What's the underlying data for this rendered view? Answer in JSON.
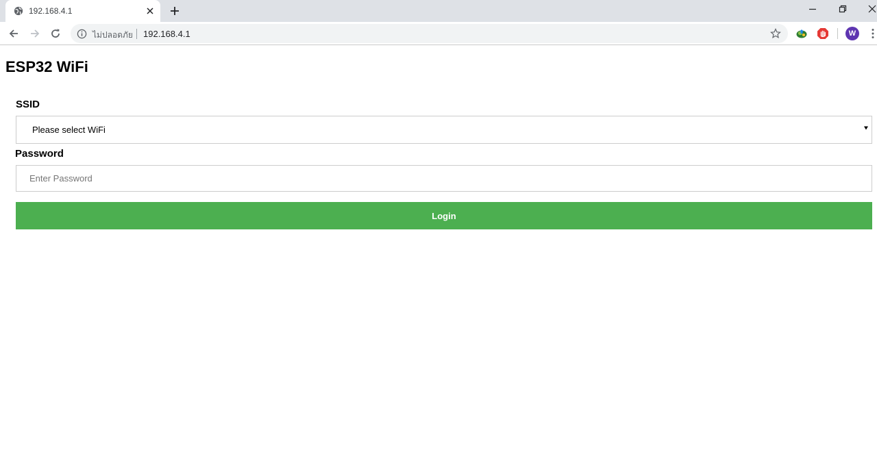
{
  "browser": {
    "tab": {
      "title": "192.168.4.1"
    },
    "address_bar": {
      "security_label": "ไม่ปลอดภัย",
      "url": "192.168.4.1"
    },
    "profile": {
      "initial": "W"
    },
    "icons": {
      "favicon": "globe-icon",
      "tab_close": "close-icon",
      "new_tab": "plus-icon",
      "minimize": "minimize-icon",
      "restore": "restore-icon",
      "close": "close-window-icon",
      "back": "back-arrow-icon",
      "forward": "forward-arrow-icon",
      "reload": "reload-icon",
      "info": "info-icon",
      "bookmark": "star-icon",
      "menu": "kebab-menu-icon"
    }
  },
  "page": {
    "title": "ESP32 WiFi",
    "form": {
      "ssid_label": "SSID",
      "ssid_selected": "Please select WiFi",
      "password_label": "Password",
      "password_placeholder": "Enter Password",
      "password_value": "",
      "login_label": "Login"
    }
  },
  "colors": {
    "login_button": "#4caf50",
    "avatar": "#5e35b1",
    "tabstrip": "#dee1e6"
  }
}
